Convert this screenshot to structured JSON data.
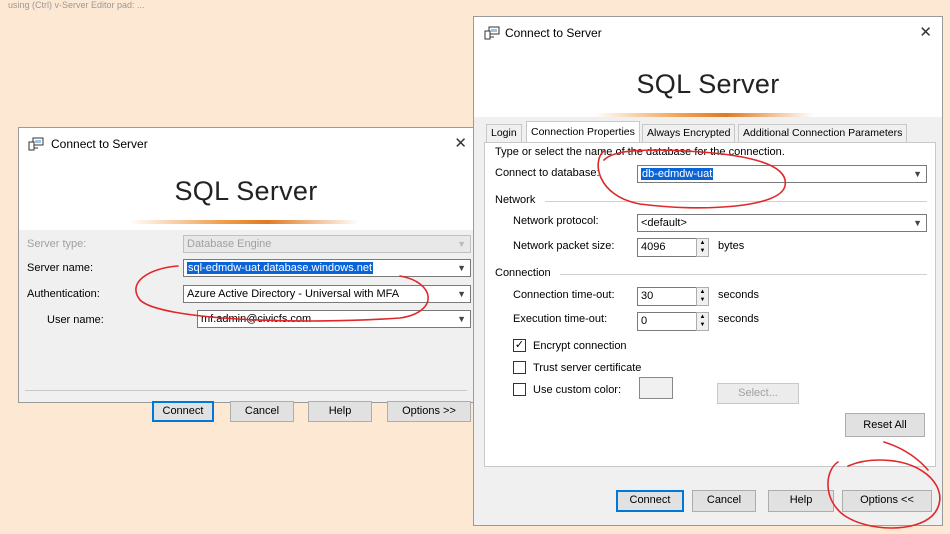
{
  "top_note": "using (Ctrl) v-Server Editor pad: ...",
  "left_dialog": {
    "title": "Connect to Server",
    "close_glyph": "✕",
    "product": "SQL Server",
    "server_type": {
      "label": "Server type:",
      "value": "Database Engine"
    },
    "server_name": {
      "label": "Server name:",
      "value": "sql-edmdw-uat.database.windows.net"
    },
    "authentication": {
      "label": "Authentication:",
      "value": "Azure Active Directory - Universal with MFA"
    },
    "user_name": {
      "label": "User name:",
      "value": "mf.admin@civicfs.com"
    },
    "buttons": {
      "connect": "Connect",
      "cancel": "Cancel",
      "help": "Help",
      "options": "Options >>"
    }
  },
  "right_dialog": {
    "title": "Connect to Server",
    "close_glyph": "✕",
    "product": "SQL Server",
    "tabs": [
      "Login",
      "Connection Properties",
      "Always Encrypted",
      "Additional Connection Parameters"
    ],
    "active_tab": "Connection Properties",
    "instruction": "Type or select the name of the database for the connection.",
    "database": {
      "label": "Connect to database:",
      "value": "db-edmdw-uat"
    },
    "network": {
      "heading": "Network",
      "protocol_label": "Network protocol:",
      "protocol_value": "<default>",
      "packet_label": "Network packet size:",
      "packet_value": "4096",
      "packet_unit": "bytes"
    },
    "connection": {
      "heading": "Connection",
      "timeout_label": "Connection time-out:",
      "timeout_value": "30",
      "timeout_unit": "seconds",
      "exec_label": "Execution time-out:",
      "exec_value": "0",
      "exec_unit": "seconds",
      "encrypt_label": "Encrypt connection",
      "encrypt_checked": true,
      "trust_label": "Trust server certificate",
      "trust_checked": false,
      "custom_color_label": "Use custom color:",
      "custom_color_checked": false,
      "select_button": "Select...",
      "reset_button": "Reset All"
    },
    "buttons": {
      "connect": "Connect",
      "cancel": "Cancel",
      "help": "Help",
      "options": "Options <<"
    }
  },
  "colors": {
    "page_bg": "#fde9d3",
    "ink": "#e0282a",
    "selection": "#0a64d8",
    "accent": "#f0a050"
  }
}
